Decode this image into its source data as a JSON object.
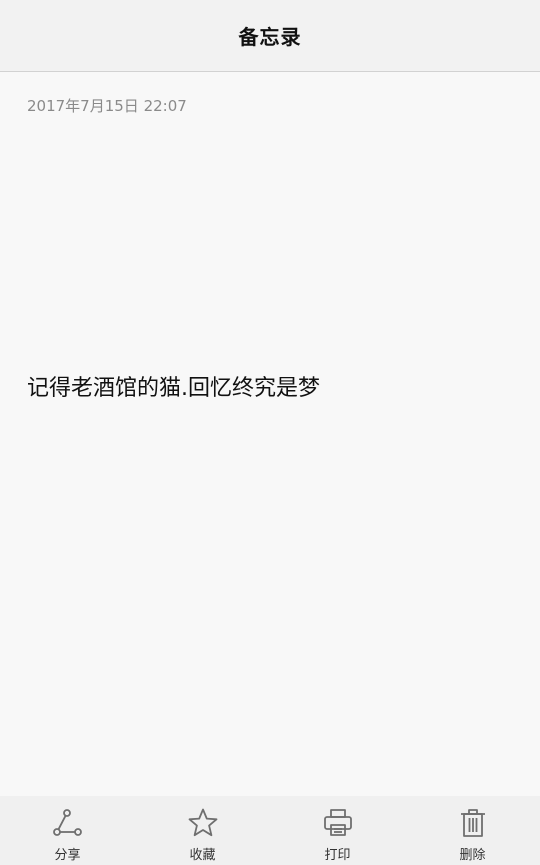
{
  "header": {
    "title": "备忘录"
  },
  "note": {
    "timestamp": "2017年7月15日 22:07",
    "body": "记得老酒馆的猫.回忆终究是梦"
  },
  "toolbar": {
    "items": [
      {
        "label": "分享",
        "icon": "share-icon"
      },
      {
        "label": "收藏",
        "icon": "star-icon"
      },
      {
        "label": "打印",
        "icon": "printer-icon"
      },
      {
        "label": "删除",
        "icon": "trash-icon"
      }
    ]
  },
  "colors": {
    "icon": "#6f6f6f",
    "text": "#111111",
    "timestamp": "#8a8a8a",
    "header_bg": "#f2f2f2",
    "toolbar_bg": "#f0f0f0",
    "background": "#f8f8f8"
  }
}
